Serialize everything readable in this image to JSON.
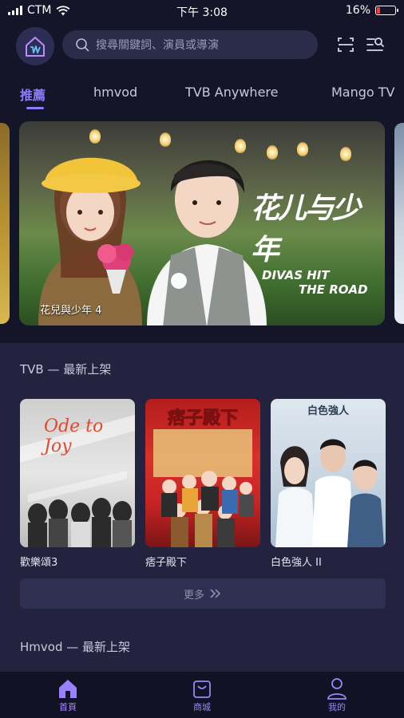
{
  "status_bar": {
    "carrier": "CTM",
    "time": "下午 3:08",
    "battery_percent": "16%",
    "battery_level": 0.16
  },
  "header": {
    "logo_icon": "home-logo-icon",
    "search_placeholder": "搜尋關鍵詞、演員或導演",
    "scan_icon": "scan-icon",
    "filter_icon": "filter-search-icon"
  },
  "tabs": [
    {
      "label": "推薦",
      "active": true
    },
    {
      "label": "hmvod",
      "active": false
    },
    {
      "label": "TVB Anywhere",
      "active": false
    },
    {
      "label": "Mango TV",
      "active": false
    }
  ],
  "banner": {
    "caption": "花兒與少年 4",
    "logo_text_cn": "花儿与少年",
    "logo_text_en_1": "DIVAS HIT",
    "logo_text_en_2": "THE ROAD"
  },
  "sections": [
    {
      "title": "TVB — 最新上架",
      "items": [
        {
          "title": "歡樂頌3",
          "poster_text": "Ode to Joy"
        },
        {
          "title": "痞子殿下",
          "poster_text": "痞子殿下"
        },
        {
          "title": "白色強人 II",
          "poster_text": "白色強人"
        }
      ],
      "more_label": "更多"
    },
    {
      "title": "Hmvod — 最新上架"
    }
  ],
  "bottom_nav": [
    {
      "label": "首頁",
      "icon": "home-icon",
      "active": true
    },
    {
      "label": "商城",
      "icon": "shopping-bag-icon",
      "active": false
    },
    {
      "label": "我的",
      "icon": "user-icon",
      "active": false
    }
  ],
  "colors": {
    "accent": "#8f7bff",
    "background": "#15152a",
    "section_background": "#24233f",
    "battery_low": "#ff3b30"
  }
}
